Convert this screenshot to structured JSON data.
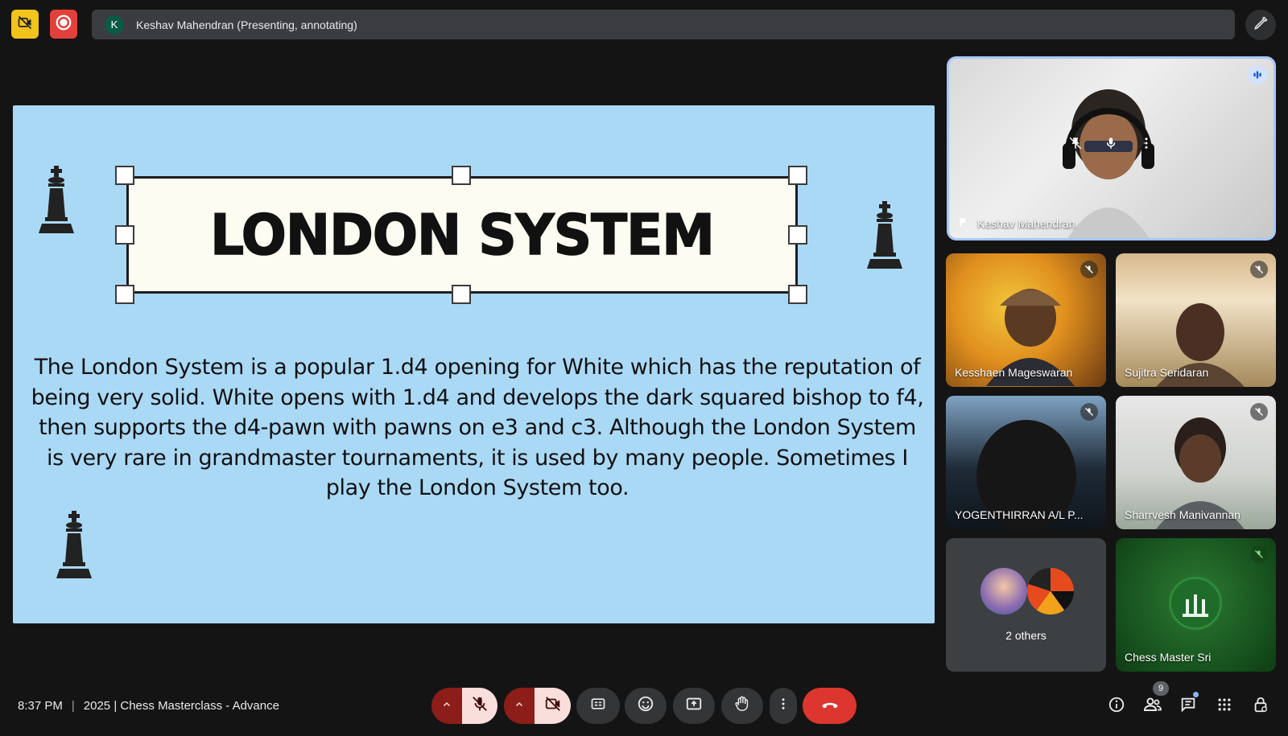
{
  "presenter_bar": {
    "avatar_letter": "K",
    "text": "Keshav Mahendran (Presenting, annotating)"
  },
  "slide": {
    "title": "LONDON SYSTEM",
    "body": "The London System is a popular 1.d4 opening for White which has the reputation of being very solid. White opens with 1.d4 and develops the dark squared bishop to f4,\nthen supports the d4-pawn with pawns on e3 and c3. Although the London System is very rare in grandmaster tournaments, it is used by many people. Sometimes I play the London System too.",
    "background_color": "#aad9f6"
  },
  "participants": {
    "main": {
      "name": "Keshav Mahendran"
    },
    "tiles": [
      {
        "name": "Kesshaen Mageswaran",
        "muted": true
      },
      {
        "name": "Sujitra Seridaran",
        "muted": true
      },
      {
        "name": "YOGENTHIRRAN A/L P...",
        "muted": true
      },
      {
        "name": "Sharrvesh Manivannan",
        "muted": true
      },
      {
        "name": "2 others"
      },
      {
        "name": "Chess Master Sri",
        "muted": true
      }
    ]
  },
  "bottom": {
    "time": "8:37 PM",
    "separator": "|",
    "meeting_title": "2025 | Chess Masterclass - Advance",
    "people_count": "9"
  },
  "colors": {
    "accent_blue": "#a8c7fa",
    "end_call": "#dc362e",
    "mic_off_bg": "#f9dedc",
    "recording_red": "#e2403a",
    "warning_yellow": "#f2c31a"
  },
  "icons": [
    "no-camera-icon",
    "record-icon",
    "pen-icon",
    "mic-off-icon",
    "camera-off-icon",
    "captions-icon",
    "emoji-icon",
    "present-icon",
    "raise-hand-icon",
    "more-icon",
    "end-call-icon",
    "info-icon",
    "people-icon",
    "chat-icon",
    "apps-icon",
    "lock-icon"
  ]
}
